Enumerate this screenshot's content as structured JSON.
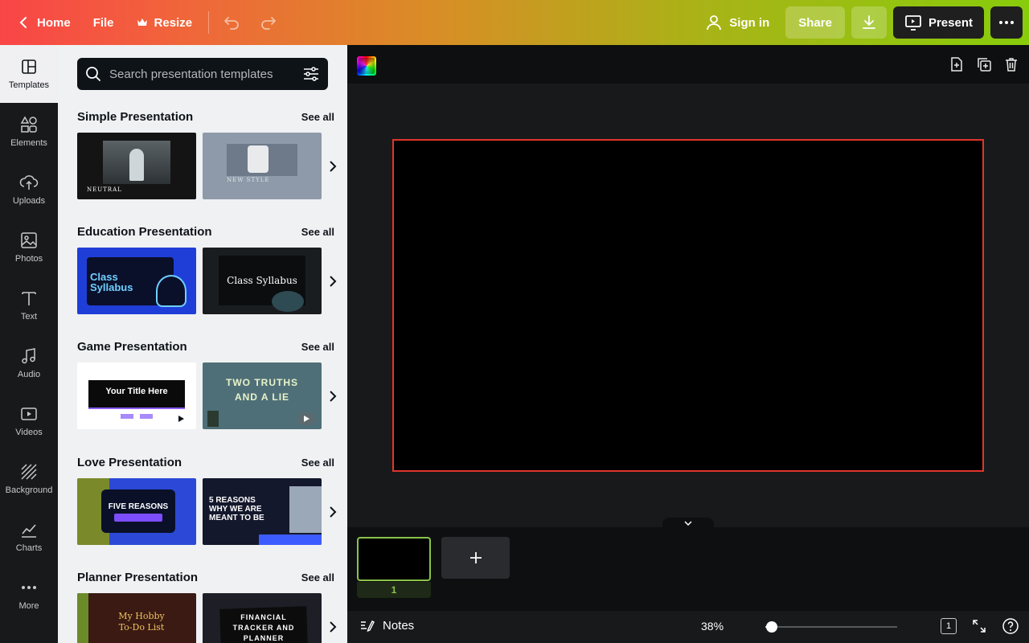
{
  "topbar": {
    "home_label": "Home",
    "file_label": "File",
    "resize_label": "Resize",
    "sign_in_label": "Sign in",
    "share_label": "Share",
    "present_label": "Present"
  },
  "rail": {
    "items": [
      {
        "label": "Templates",
        "icon": "templates-icon"
      },
      {
        "label": "Elements",
        "icon": "elements-icon"
      },
      {
        "label": "Uploads",
        "icon": "upload-icon"
      },
      {
        "label": "Photos",
        "icon": "photo-icon"
      },
      {
        "label": "Text",
        "icon": "text-icon"
      },
      {
        "label": "Audio",
        "icon": "music-icon"
      },
      {
        "label": "Videos",
        "icon": "video-icon"
      },
      {
        "label": "Background",
        "icon": "background-icon"
      },
      {
        "label": "Charts",
        "icon": "chart-icon"
      },
      {
        "label": "More",
        "icon": "ellipsis-icon"
      }
    ]
  },
  "panel": {
    "search_placeholder": "Search presentation templates",
    "see_all_label": "See all",
    "sections": [
      {
        "title": "Simple Presentation",
        "thumbs": [
          {
            "text": "NEUTRAL"
          },
          {
            "text": "NEW STYLE"
          }
        ]
      },
      {
        "title": "Education Presentation",
        "thumbs": [
          {
            "text": "Class Syllabus"
          },
          {
            "text": "Class Syllabus"
          }
        ]
      },
      {
        "title": "Game Presentation",
        "thumbs": [
          {
            "text": "Your Title Here"
          },
          {
            "text": "TWO TRUTHS AND A LIE"
          }
        ]
      },
      {
        "title": "Love Presentation",
        "thumbs": [
          {
            "text": "FIVE REASONS"
          },
          {
            "text": "5 REASONS WHY WE ARE MEANT TO BE"
          }
        ]
      },
      {
        "title": "Planner Presentation",
        "thumbs": [
          {
            "text": "My Hobby To-Do List"
          },
          {
            "text": "FINANCIAL TRACKER AND PLANNER"
          }
        ]
      }
    ]
  },
  "filmstrip": {
    "page_number": "1"
  },
  "status": {
    "notes_label": "Notes",
    "zoom": "38%",
    "zoom_fraction": 0.05,
    "page_count": "1"
  },
  "colors": {
    "slide_border": "#e0352b",
    "active_page": "#8bc34a"
  }
}
